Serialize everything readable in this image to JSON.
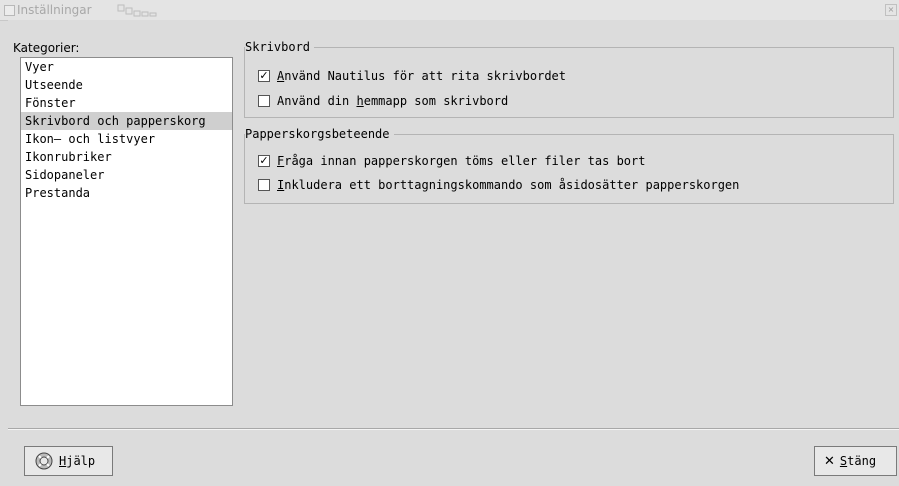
{
  "window": {
    "title": "Inställningar"
  },
  "categories": {
    "label": "Kategorier:",
    "items": [
      {
        "label": "Vyer"
      },
      {
        "label": "Utseende"
      },
      {
        "label": "Fönster"
      },
      {
        "label": "Skrivbord och papperskorg",
        "selected": true
      },
      {
        "label": "Ikon– och listvyer"
      },
      {
        "label": "Ikonrubriker"
      },
      {
        "label": "Sidopaneler"
      },
      {
        "label": "Prestanda"
      }
    ]
  },
  "desktop_frame": {
    "title": "Skrivbord",
    "options": [
      {
        "first": "A",
        "rest": "nvänd Nautilus för att rita skrivbordet",
        "pre": "",
        "checked": true
      },
      {
        "pre": "Använd din ",
        "first": "h",
        "rest": "emmapp som skrivbord",
        "checked": false
      }
    ]
  },
  "trash_frame": {
    "title": "Papperskorgsbeteende",
    "options": [
      {
        "pre": "",
        "first": "F",
        "rest": "råga innan papperskorgen töms eller filer tas bort",
        "checked": true
      },
      {
        "pre": "",
        "first": "I",
        "rest": "nkludera ett borttagningskommando som åsidosätter papperskorgen",
        "checked": false
      }
    ]
  },
  "buttons": {
    "help": {
      "first": "H",
      "rest": "jälp"
    },
    "close": {
      "pre": "",
      "first": "S",
      "rest": "täng"
    }
  },
  "icons": {
    "help": "lifebuoy-help-icon",
    "close": "x-close-icon",
    "check": "✓"
  }
}
